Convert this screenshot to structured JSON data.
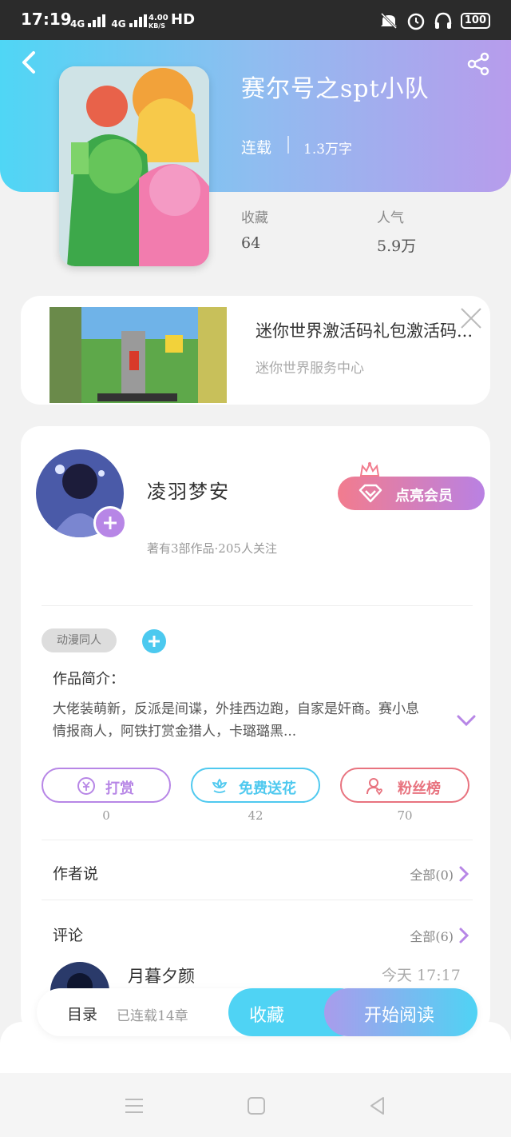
{
  "status_bar": {
    "time": "17:19",
    "net1": "4G",
    "net2": "4G",
    "speed_value": "4.00",
    "speed_unit": "KB/S",
    "hd": "HD",
    "battery": "100"
  },
  "book": {
    "title": "赛尔号之spt小队",
    "status": "连载",
    "words": "1.3万字",
    "collect_label": "收藏",
    "collect_value": "64",
    "popularity_label": "人气",
    "popularity_value": "5.9万"
  },
  "ad": {
    "title": "迷你世界激活码礼包激活码...",
    "source": "迷你世界服务中心"
  },
  "author": {
    "name": "凌羽梦安",
    "meta": "著有3部作品·205人关注",
    "vip_button": "点亮会员"
  },
  "tags": [
    "动漫同人"
  ],
  "intro": {
    "title": "作品简介：",
    "text": "大佬装萌新，反派是间谍，外挂西边跑，自家是奸商。赛小息情报商人，阿铁打赏金猎人，卡璐璐黑..."
  },
  "actions": [
    {
      "label": "打赏",
      "count": "0",
      "color": "#b786e6"
    },
    {
      "label": "免费送花",
      "count": "42",
      "color": "#4fc9ef"
    },
    {
      "label": "粉丝榜",
      "count": "70",
      "color": "#e8737f"
    }
  ],
  "sections": {
    "author_says": {
      "title": "作者说",
      "link": "全部(0)"
    },
    "comments": {
      "title": "评论",
      "link": "全部(6)"
    }
  },
  "comment": {
    "name": "月暮夕颜",
    "time": "今天 17:17"
  },
  "bottom_bar": {
    "toc": "目录",
    "progress": "已连载14章",
    "collect": "收藏",
    "read": "开始阅读"
  }
}
